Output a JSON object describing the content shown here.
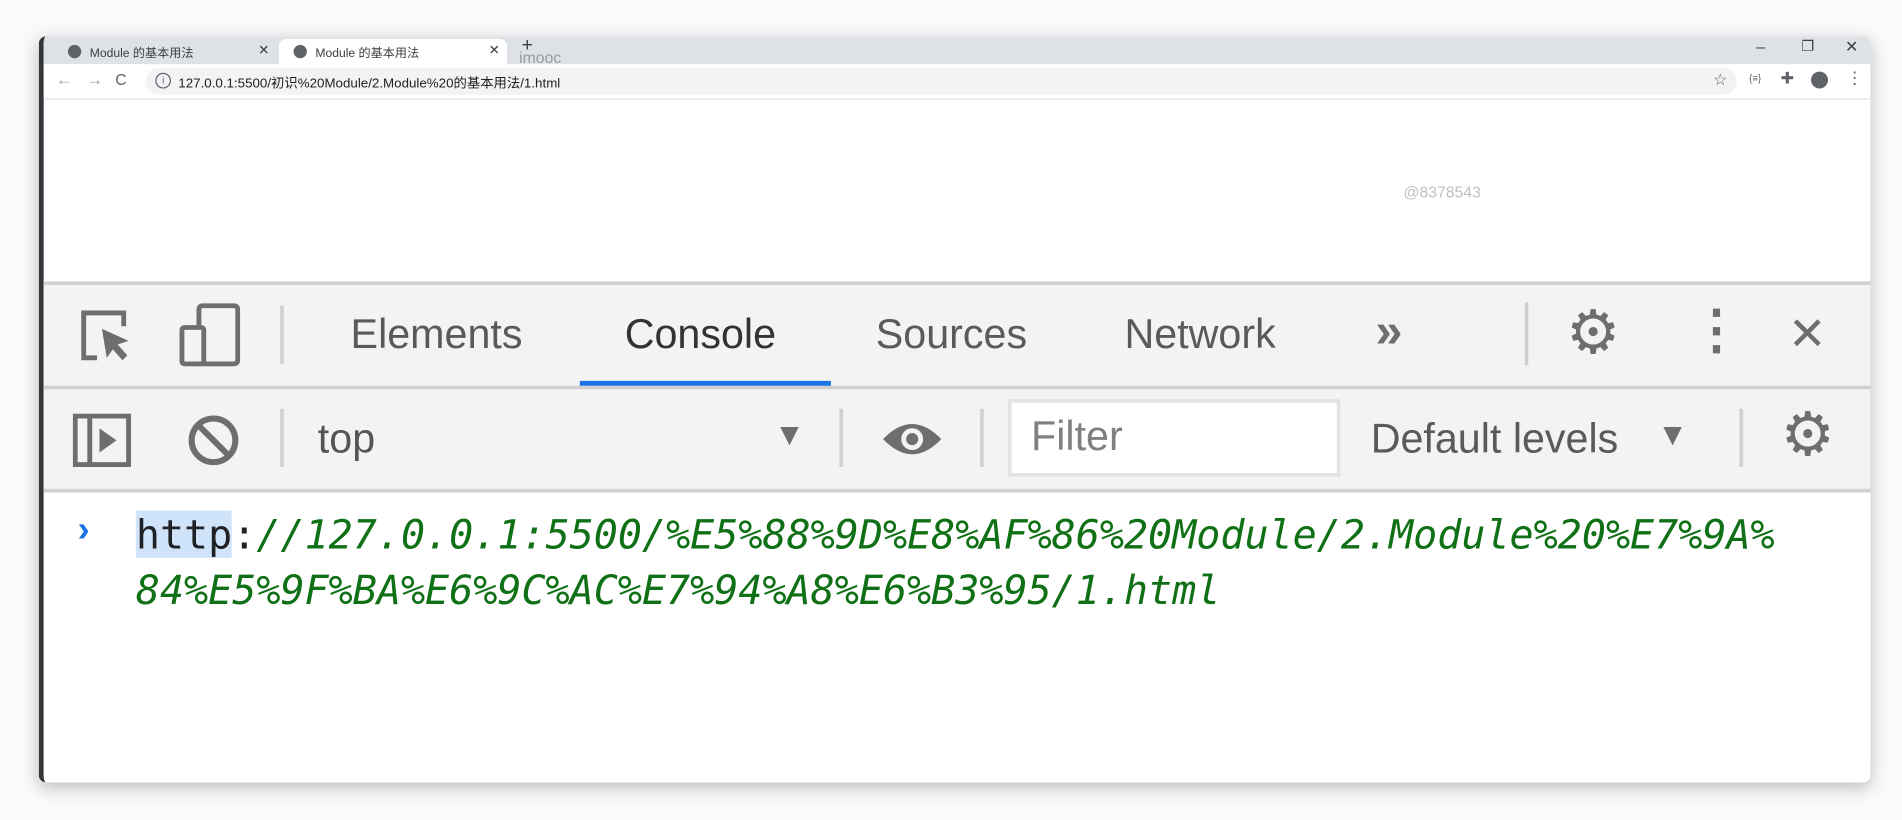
{
  "browser": {
    "tabs": [
      {
        "title": "Module 的基本用法",
        "active": false
      },
      {
        "title": "Module 的基本用法",
        "active": true
      }
    ],
    "new_tab_label": "+",
    "watermark": "imooc",
    "url": "127.0.0.1:5500/初识%20Module/2.Module%20的基本用法/1.html",
    "page_watermark": "@8378543"
  },
  "devtools": {
    "tabs": [
      {
        "label": "Elements",
        "active": false
      },
      {
        "label": "Console",
        "active": true
      },
      {
        "label": "Sources",
        "active": false
      },
      {
        "label": "Network",
        "active": false
      }
    ],
    "more_label": "»",
    "context": "top",
    "filter_placeholder": "Filter",
    "levels": "Default levels",
    "accent": "#1a73e8"
  },
  "console": {
    "entries": [
      {
        "scheme": "http",
        "colon": ":",
        "rest": "//127.0.0.1:5500/%E5%88%9D%E8%AF%86%20Module/2.Module%20%E7%9A%84%E5%9F%BA%E6%9C%AC%E7%94%A8%E6%B3%95/1.html",
        "color": "#107016"
      }
    ]
  }
}
